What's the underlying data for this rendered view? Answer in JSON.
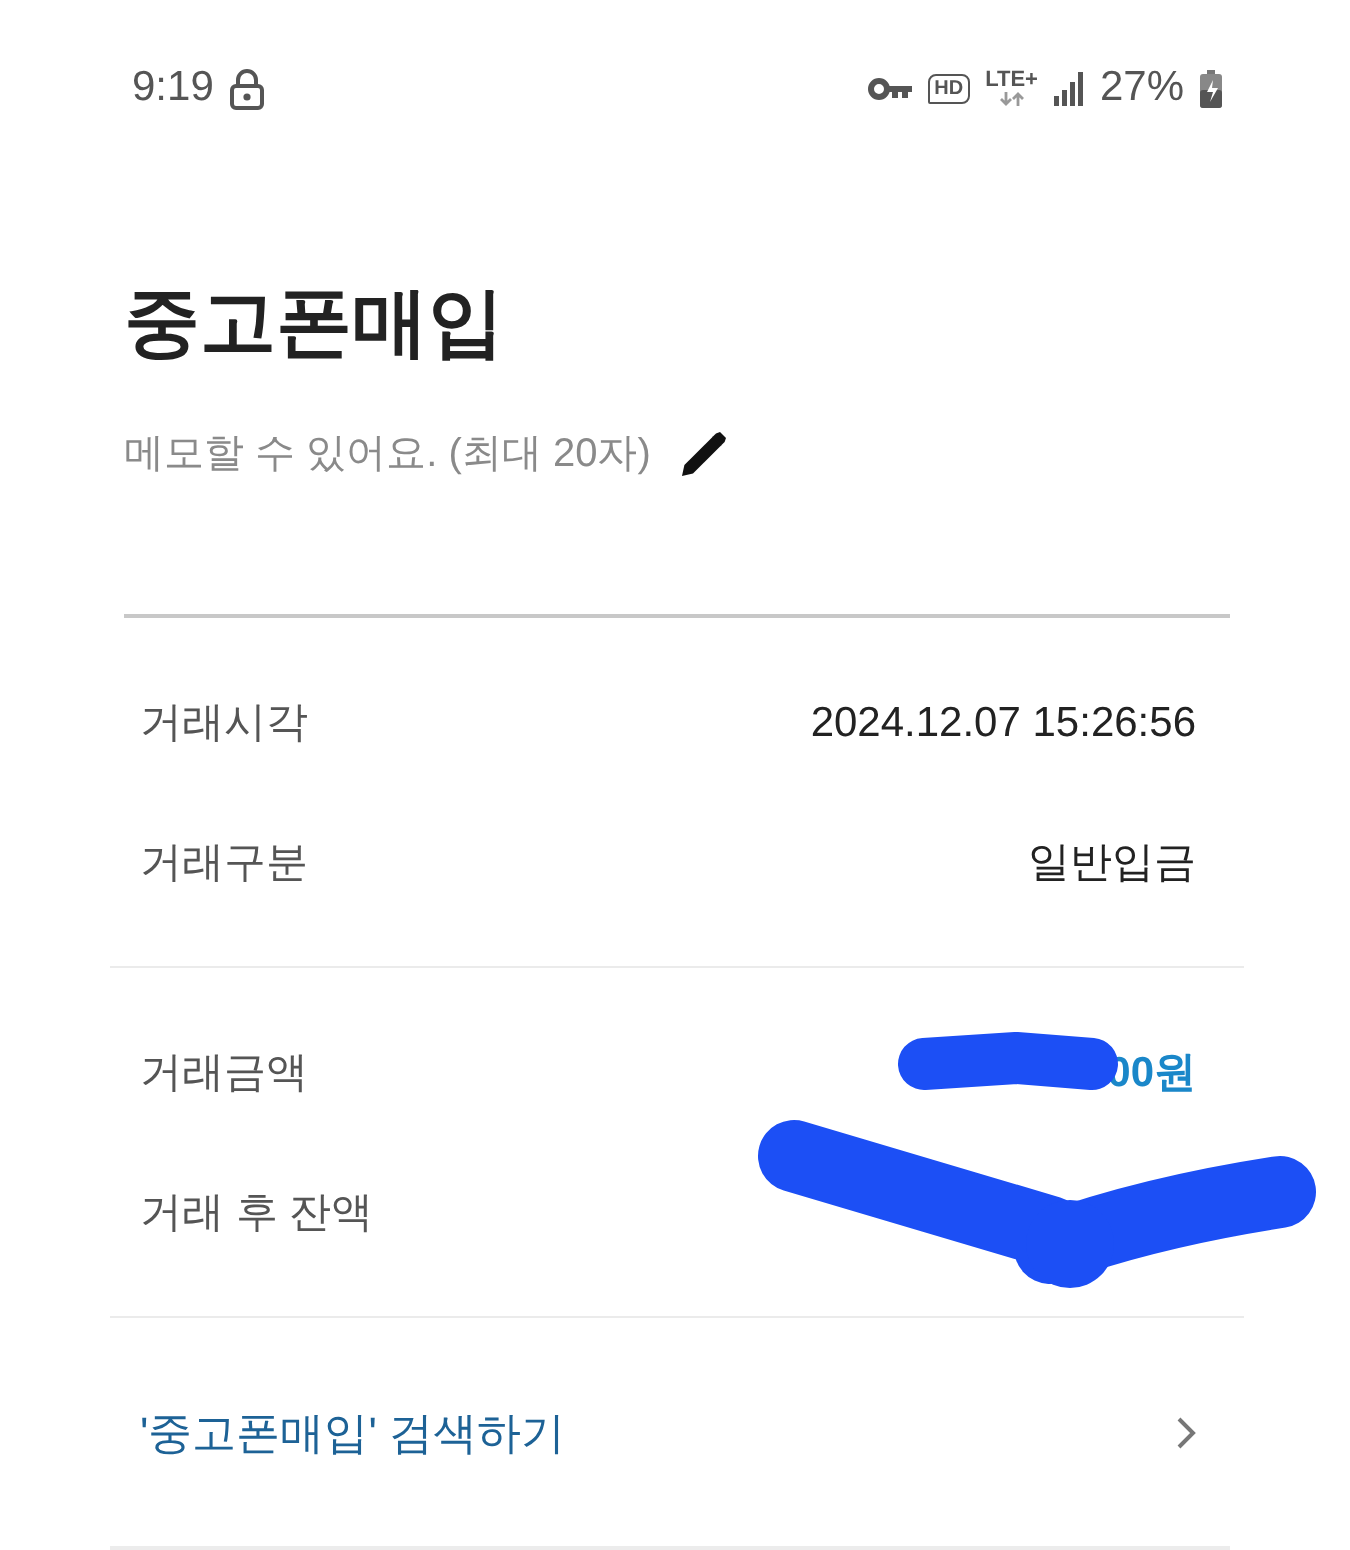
{
  "status_bar": {
    "time": "9:19",
    "hd_label": "HD",
    "network": "LTE+",
    "battery": "27%"
  },
  "header": {
    "title": "중고폰매입",
    "memo_hint": "메모할 수 있어요. (최대 20자)"
  },
  "sections": [
    {
      "rows": [
        {
          "label": "거래시각",
          "value": "2024.12.07 15:26:56",
          "kind": "plain",
          "redacted": false
        },
        {
          "label": "거래구분",
          "value": "일반입금",
          "kind": "plain",
          "redacted": false
        }
      ]
    },
    {
      "rows": [
        {
          "label": "거래금액",
          "value": "00원",
          "kind": "amount",
          "redacted": true
        },
        {
          "label": "거래 후 잔액",
          "kind": "plain",
          "redacted": true
        }
      ]
    }
  ],
  "search_link": {
    "text": "'중고폰매입' 검색하기"
  }
}
